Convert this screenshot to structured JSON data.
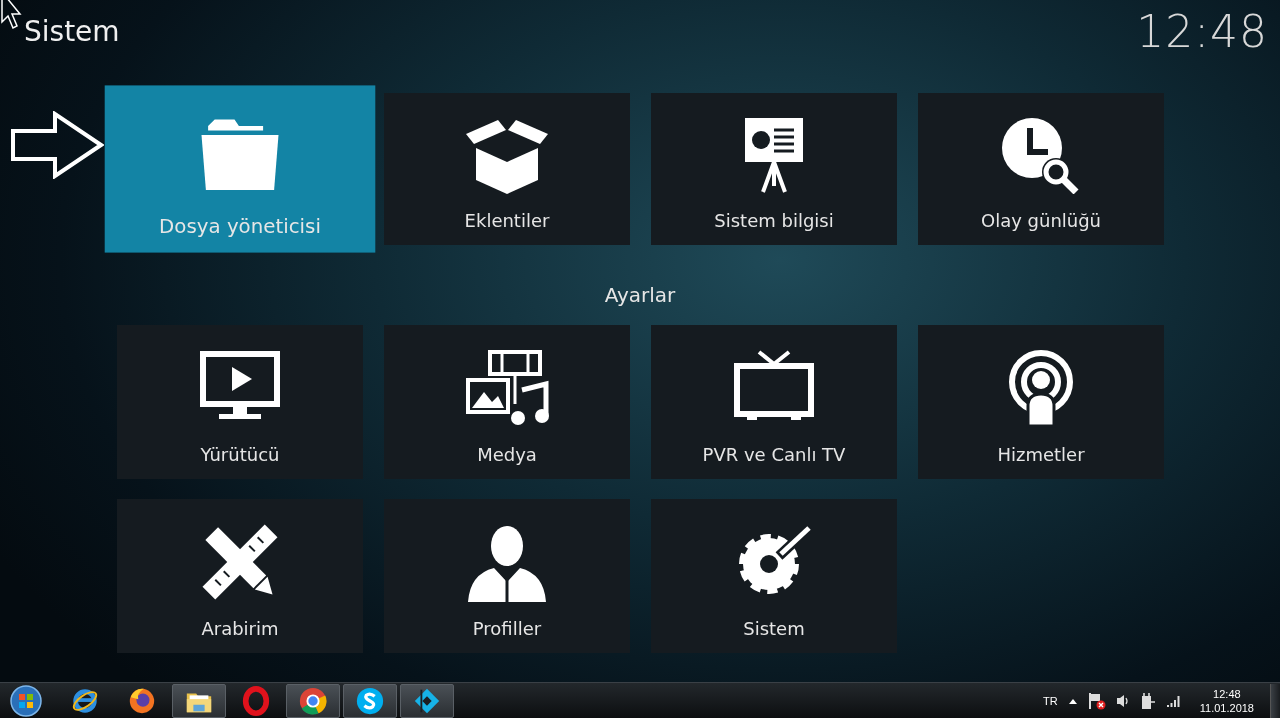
{
  "header": {
    "title": "Sistem",
    "clock": "12:48"
  },
  "top_items": [
    {
      "label": "Dosya yöneticisi",
      "selected": true
    },
    {
      "label": "Eklentiler",
      "selected": false
    },
    {
      "label": "Sistem bilgisi",
      "selected": false
    },
    {
      "label": "Olay günlüğü",
      "selected": false
    }
  ],
  "section": {
    "title": "Ayarlar"
  },
  "settings_items": [
    {
      "label": "Yürütücü",
      "selected": false
    },
    {
      "label": "Medya",
      "selected": false
    },
    {
      "label": "PVR ve Canlı TV",
      "selected": false
    },
    {
      "label": "Hizmetler",
      "selected": false
    },
    {
      "label": "Arabirim",
      "selected": false
    },
    {
      "label": "Profiller",
      "selected": false
    },
    {
      "label": "Sistem",
      "selected": false
    }
  ],
  "taskbar": {
    "apps": [
      {
        "running": false
      },
      {
        "running": false
      },
      {
        "running": true
      },
      {
        "running": false
      },
      {
        "running": true
      },
      {
        "running": true
      },
      {
        "running": true
      }
    ],
    "tray": {
      "language": "TR",
      "time": "12:48",
      "date": "11.01.2018"
    }
  }
}
